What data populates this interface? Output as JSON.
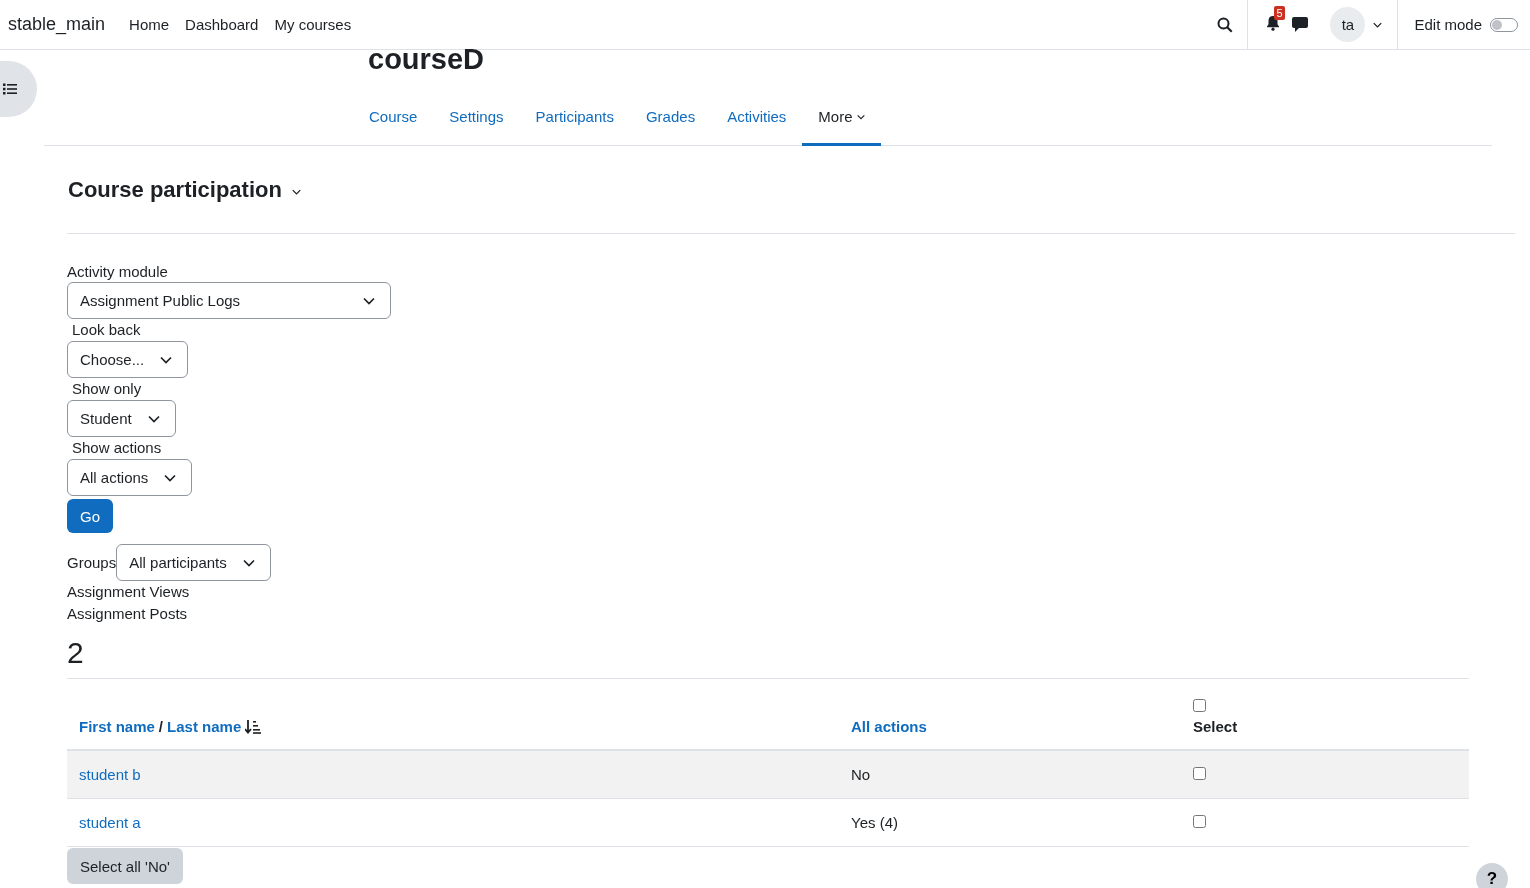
{
  "site_name": "stable_main",
  "nav_links": [
    {
      "label": "Home"
    },
    {
      "label": "Dashboard"
    },
    {
      "label": "My courses"
    }
  ],
  "notifications": {
    "count": "5"
  },
  "user": {
    "initials": "ta"
  },
  "edit_mode": {
    "label": "Edit mode",
    "on": false
  },
  "course": {
    "title": "courseD"
  },
  "tabs": [
    {
      "label": "Course",
      "kind": "link",
      "selected": false
    },
    {
      "label": "Settings",
      "kind": "link",
      "selected": false
    },
    {
      "label": "Participants",
      "kind": "link",
      "selected": false
    },
    {
      "label": "Grades",
      "kind": "link",
      "selected": false
    },
    {
      "label": "Activities",
      "kind": "link",
      "selected": false
    },
    {
      "label": "More",
      "kind": "dropdown",
      "selected": true
    }
  ],
  "page_heading": "Course participation",
  "filters": [
    {
      "label": "Activity module",
      "value": "Assignment Public Logs"
    },
    {
      "label": "Look back",
      "value": "Choose..."
    },
    {
      "label": "Show only",
      "value": "Student"
    },
    {
      "label": "Show actions",
      "value": "All actions"
    }
  ],
  "go_button": "Go",
  "groups": {
    "label": "Groups",
    "value": "All participants"
  },
  "summary_lines": [
    "Assignment Views",
    "Assignment Posts"
  ],
  "count": "2",
  "table": {
    "name_header": {
      "first": "First name",
      "separator": "/",
      "last": "Last name"
    },
    "actions_header": "All actions",
    "select_header": {
      "label": "Select",
      "checked": false
    },
    "rows": [
      {
        "name": "student b",
        "action": "No",
        "checked": false
      },
      {
        "name": "student a",
        "action": "Yes (4)",
        "checked": false
      }
    ]
  },
  "select_all_button": "Select all 'No'",
  "help_button": "?"
}
